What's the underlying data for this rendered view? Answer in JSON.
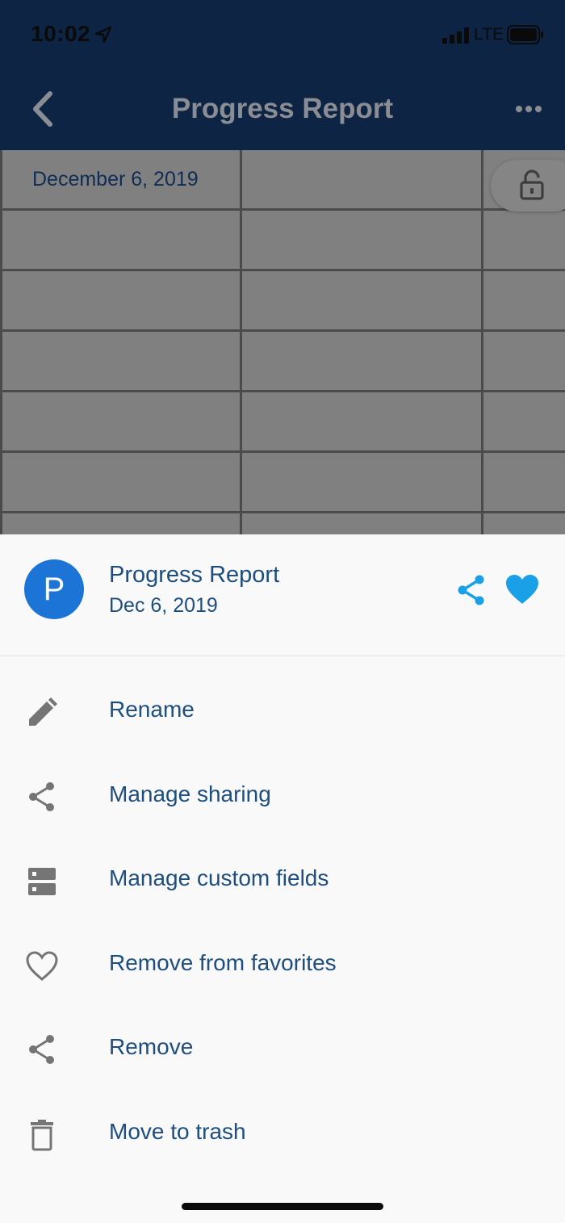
{
  "status_bar": {
    "time": "10:02",
    "network": "LTE"
  },
  "nav": {
    "title": "Progress Report"
  },
  "sheet": {
    "cell_date": "December 6, 2019"
  },
  "action_sheet": {
    "avatar_letter": "P",
    "doc_title": "Progress Report",
    "doc_date": "Dec 6, 2019",
    "accent_color": "#1aa0e6",
    "menu": [
      {
        "label": "Rename",
        "icon": "pencil-icon"
      },
      {
        "label": "Manage sharing",
        "icon": "share-icon"
      },
      {
        "label": "Manage custom fields",
        "icon": "custom-fields-icon"
      },
      {
        "label": "Remove from favorites",
        "icon": "heart-outline-icon"
      },
      {
        "label": "Remove",
        "icon": "share-icon"
      },
      {
        "label": "Move to trash",
        "icon": "trash-icon"
      }
    ]
  }
}
